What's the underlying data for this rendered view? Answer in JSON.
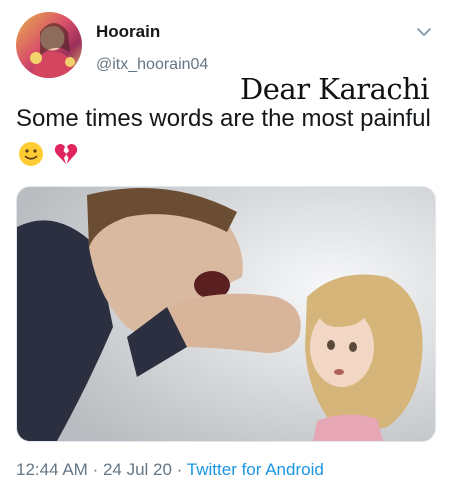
{
  "author": {
    "name": "Hoorain",
    "handle": "@itx_hoorain04",
    "avatar_icon": "profile-avatar"
  },
  "tweet": {
    "text": "Some times words are the most painful",
    "emojis": [
      "slightly-smiling-face-emoji",
      "broken-heart-emoji"
    ]
  },
  "overlay_caption": "Dear Karachi",
  "media": {
    "description_icon": "illustration-image"
  },
  "meta": {
    "time": "12:44 AM",
    "separator": "·",
    "date": "24 Jul 20",
    "source": "Twitter for Android"
  },
  "colors": {
    "text": "#14171a",
    "secondary": "#657786",
    "link": "#1b95e0"
  }
}
